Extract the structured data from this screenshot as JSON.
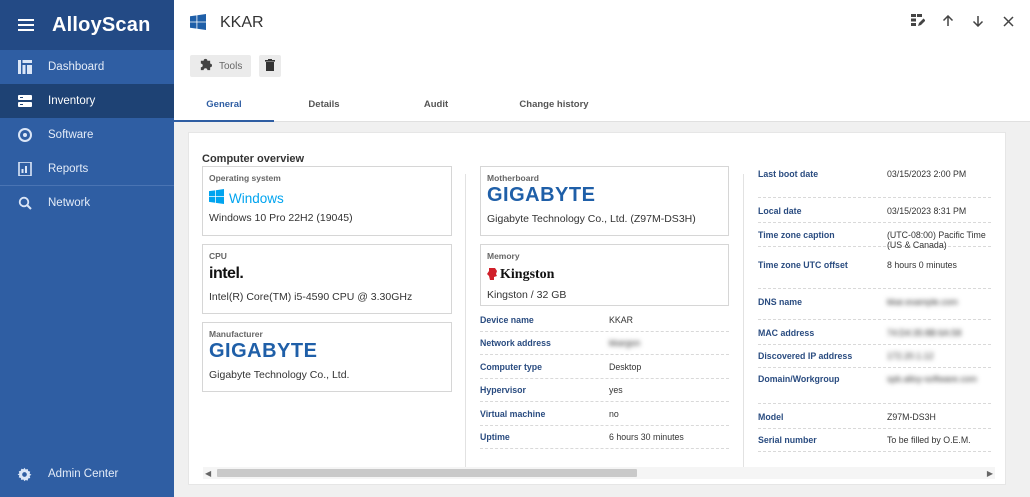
{
  "app": {
    "name": "AlloyScan"
  },
  "sidebar": {
    "items": [
      {
        "label": "Dashboard",
        "icon": "dashboard-icon"
      },
      {
        "label": "Inventory",
        "icon": "inventory-icon"
      },
      {
        "label": "Software",
        "icon": "software-icon"
      },
      {
        "label": "Reports",
        "icon": "reports-icon"
      },
      {
        "label": "Network",
        "icon": "network-icon"
      }
    ],
    "bottom": {
      "label": "Admin Center",
      "icon": "gear-icon"
    }
  },
  "header": {
    "title": "KKAR",
    "os_icon": "windows-icon"
  },
  "toolbar": {
    "tools_label": "Tools"
  },
  "tabs": [
    "General",
    "Details",
    "Audit",
    "Change history"
  ],
  "overview": {
    "title": "Computer overview",
    "cards": {
      "os": {
        "label": "Operating system",
        "brand": "Windows",
        "value": "Windows 10 Pro 22H2 (19045)"
      },
      "cpu": {
        "label": "CPU",
        "brand": "intel.",
        "value": "Intel(R) Core(TM) i5-4590 CPU @ 3.30GHz"
      },
      "manufacturer": {
        "label": "Manufacturer",
        "brand": "GIGABYTE",
        "value": "Gigabyte Technology Co., Ltd."
      },
      "motherboard": {
        "label": "Motherboard",
        "brand": "GIGABYTE",
        "value": "Gigabyte Technology Co., Ltd. (Z97M-DS3H)"
      },
      "memory": {
        "label": "Memory",
        "brand": "Kingston",
        "value": "Kingston / 32 GB"
      }
    },
    "middle": [
      {
        "k": "Device name",
        "v": "KKAR",
        "blurred": false
      },
      {
        "k": "Network address",
        "v": "kkargon",
        "blurred": true
      },
      {
        "k": "Computer type",
        "v": "Desktop",
        "blurred": false
      },
      {
        "k": "Hypervisor",
        "v": "yes",
        "blurred": false
      },
      {
        "k": "Virtual machine",
        "v": "no",
        "blurred": false
      },
      {
        "k": "Uptime",
        "v": "6 hours 30 minutes",
        "blurred": false
      }
    ],
    "right": [
      {
        "k": "Last boot date",
        "v": "03/15/2023 2:00 PM",
        "blurred": false
      },
      {
        "k": "Local date",
        "v": "03/15/2023 8:31 PM",
        "blurred": false
      },
      {
        "k": "Time zone caption",
        "v": "(UTC-08:00) Pacific Time (US & Canada)",
        "blurred": false
      },
      {
        "k": "Time zone UTC offset",
        "v": "8 hours 0 minutes",
        "blurred": false
      },
      {
        "k": "DNS name",
        "v": "kkar.example.com",
        "blurred": true
      },
      {
        "k": "MAC address",
        "v": "74:D4:35:8B:6A:58",
        "blurred": true
      },
      {
        "k": "Discovered IP address",
        "v": "172.20.1.12",
        "blurred": true
      },
      {
        "k": "Domain/Workgroup",
        "v": "spb.alloy-software.com",
        "blurred": true
      },
      {
        "k": "Model",
        "v": "Z97M-DS3H",
        "blurred": false
      },
      {
        "k": "Serial number",
        "v": "To be filled by O.E.M.",
        "blurred": false
      }
    ]
  },
  "colors": {
    "sidebar": "#2f5ea3",
    "sidebar_dark": "#234a85",
    "accent": "#2f5ea3",
    "gigabyte": "#1f5fa8",
    "windows": "#00a4ef",
    "kingston_red": "#d0202a"
  }
}
